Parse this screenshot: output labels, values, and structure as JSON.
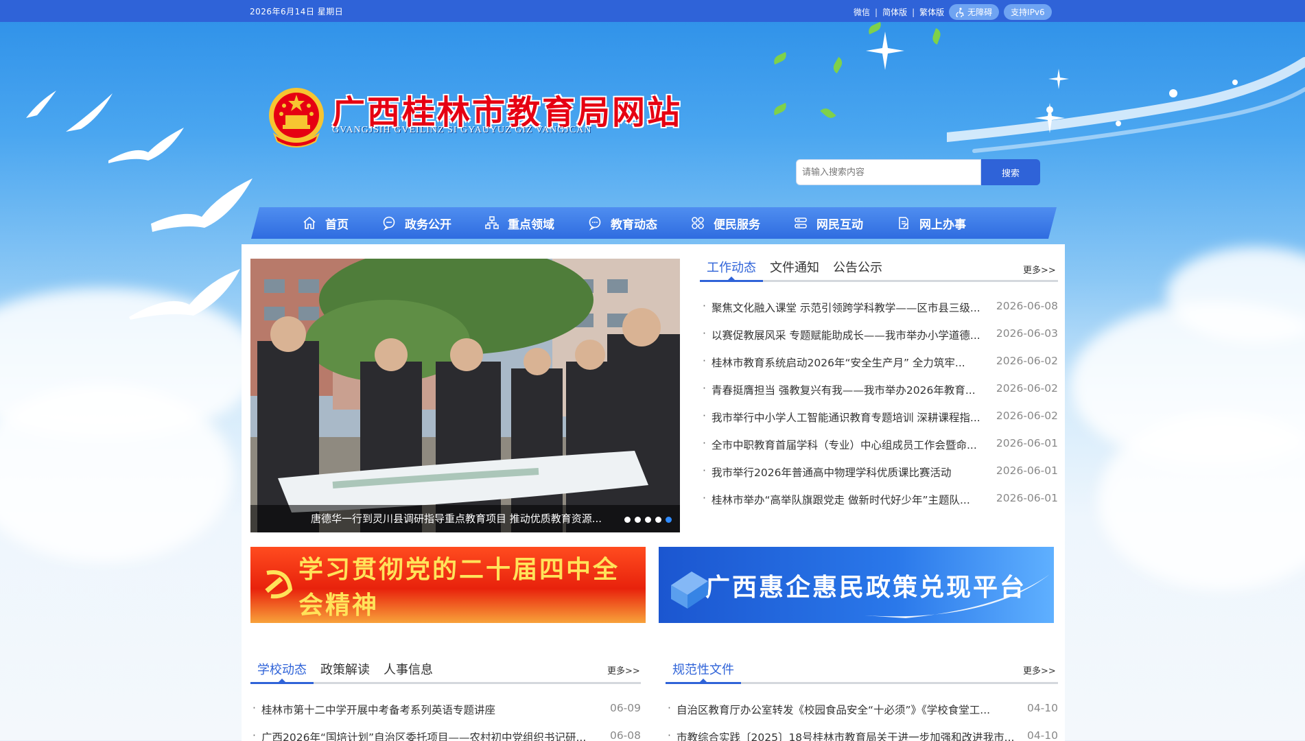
{
  "topbar": {
    "date": "2026年6月14日 星期日",
    "links": [
      "微信",
      "简体版",
      "繁体版"
    ],
    "accessibility_label": "无障碍",
    "ipv6_label": "支持IPv6"
  },
  "header": {
    "title": "广西桂林市教育局网站",
    "subtitle": "GVANGJSIH GVEILINZ SI GYAUYUZ GIZ VANGJCAN"
  },
  "search": {
    "placeholder": "请输入搜索内容",
    "button_label": "搜索"
  },
  "nav": {
    "items": [
      {
        "label": "首页",
        "icon": "home-icon"
      },
      {
        "label": "政务公开",
        "icon": "chat-icon"
      },
      {
        "label": "重点领域",
        "icon": "hierarchy-icon"
      },
      {
        "label": "教育动态",
        "icon": "message-icon"
      },
      {
        "label": "便民服务",
        "icon": "grid-icon"
      },
      {
        "label": "网民互动",
        "icon": "server-icon"
      },
      {
        "label": "网上办事",
        "icon": "document-icon"
      }
    ]
  },
  "slider": {
    "caption": "唐德华一行到灵川县调研指导重点教育项目 推动优质教育资源...",
    "dot_count": 5,
    "active_dot": 5
  },
  "news_panel": {
    "tabs": [
      "工作动态",
      "文件通知",
      "公告公示"
    ],
    "more": "更多>>",
    "items": [
      {
        "title": "聚焦文化融入课堂 示范引领跨学科教学——区市县三级...",
        "date": "2026-06-08"
      },
      {
        "title": "以赛促教展风采 专题赋能助成长——我市举办小学道德...",
        "date": "2026-06-03"
      },
      {
        "title": "桂林市教育系统启动2026年“安全生产月” 全力筑牢...",
        "date": "2026-06-02"
      },
      {
        "title": "青春挺膺担当 强教复兴有我——我市举办2026年教育...",
        "date": "2026-06-02"
      },
      {
        "title": "我市举行中小学人工智能通识教育专题培训 深耕课程指...",
        "date": "2026-06-02"
      },
      {
        "title": "全市中职教育首届学科（专业）中心组成员工作会暨命...",
        "date": "2026-06-01"
      },
      {
        "title": "我市举行2026年普通高中物理学科优质课比赛活动",
        "date": "2026-06-01"
      },
      {
        "title": "桂林市举办“高举队旗跟党走 做新时代好少年”主题队...",
        "date": "2026-06-01"
      }
    ]
  },
  "banners": {
    "left": "学习贯彻党的二十届四中全会精神",
    "right": "广西惠企惠民政策兑现平台"
  },
  "school_panel": {
    "tabs": [
      "学校动态",
      "政策解读",
      "人事信息"
    ],
    "more": "更多>>",
    "items": [
      {
        "title": "桂林市第十二中学开展中考备考系列英语专题讲座",
        "date": "06-09"
      },
      {
        "title": "广西2026年“国培计划”自治区委托项目——农村初中党组织书记研...",
        "date": "06-08"
      }
    ]
  },
  "regulation_panel": {
    "tabs": [
      "规范性文件"
    ],
    "more": "更多>>",
    "items": [
      {
        "title": "自治区教育厅办公室转发《校园食品安全“十必须”》《学校食堂工...",
        "date": "04-10"
      },
      {
        "title": "市教综合实践〔2025〕18号桂林市教育局关于进一步加强和改进我市...",
        "date": "04-10"
      }
    ]
  },
  "colors": {
    "primary": "#2f63d8",
    "title_red": "#e60012",
    "active_dot": "#2f8bff"
  }
}
